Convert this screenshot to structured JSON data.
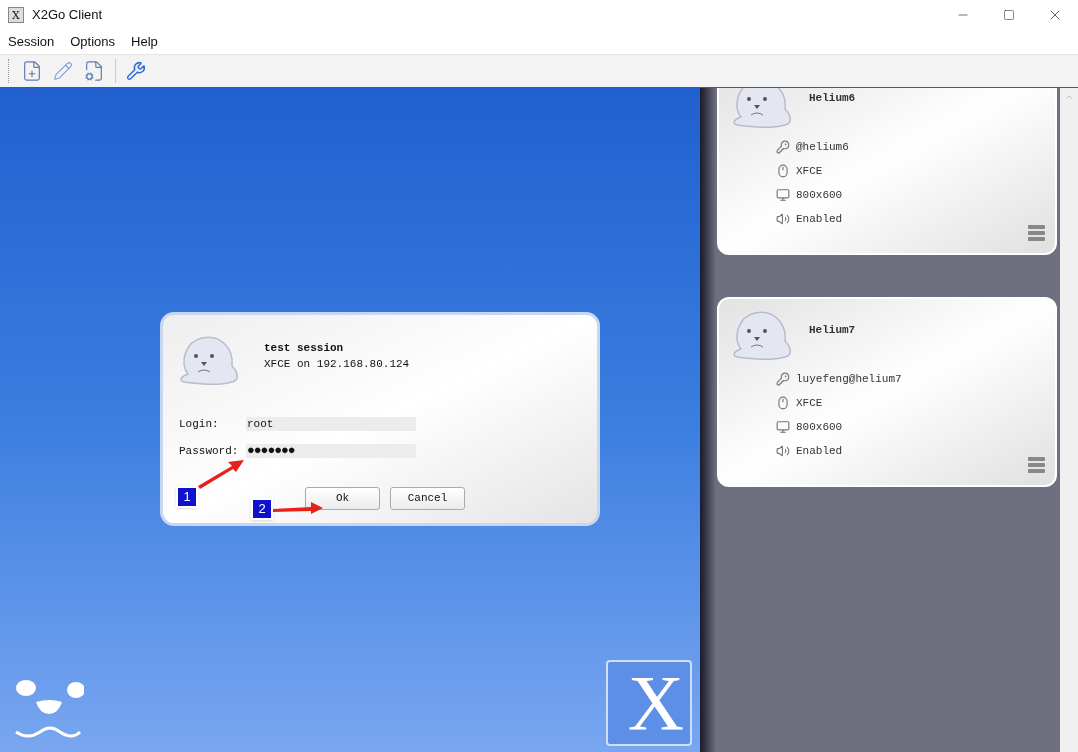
{
  "window": {
    "title": "X2Go Client"
  },
  "menu": [
    "Session",
    "Options",
    "Help"
  ],
  "dialog": {
    "title": "test session",
    "subtitle": "XFCE on 192.168.80.124",
    "fields": [
      {
        "label": "Login:",
        "value": "root"
      },
      {
        "label": "Password:",
        "value": "●●●●●●●"
      }
    ],
    "buttons": [
      "Ok",
      "Cancel"
    ]
  },
  "annotations": [
    "1",
    "2"
  ],
  "logo": {
    "letter": "X"
  },
  "app_icon": {
    "letter": "X"
  },
  "sessions": [
    {
      "name": "Helium6",
      "login": "@helium6",
      "desktop": "XFCE",
      "geometry": "800x600",
      "sound": "Enabled"
    },
    {
      "name": "Helium7",
      "login": "luyefeng@helium7",
      "desktop": "XFCE",
      "geometry": "800x600",
      "sound": "Enabled"
    }
  ]
}
